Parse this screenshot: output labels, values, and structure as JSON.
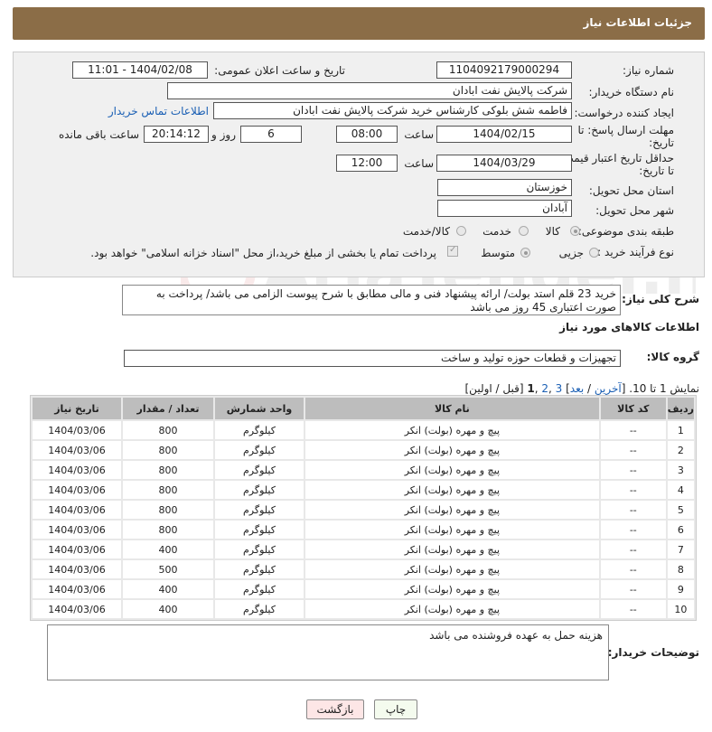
{
  "header": {
    "title": "جزئیات اطلاعات نیاز"
  },
  "form": {
    "need_number_label": "شماره نیاز:",
    "need_number": "1104092179000294",
    "announce_label": "تاریخ و ساعت اعلان عمومی:",
    "announce_value": "1404/02/08 - 11:01",
    "buyer_org_label": "نام دستگاه خریدار:",
    "buyer_org": "شرکت پالایش نفت ابادان",
    "creator_label": "ایجاد کننده درخواست:",
    "creator": "فاطمه شش بلوکی کارشناس خرید شرکت پالایش نفت ابادان",
    "contact_link": "اطلاعات تماس خریدار",
    "deadline_label1": "مهلت ارسال پاسخ: تا",
    "deadline_label2": "تاریخ:",
    "deadline_date": "1404/02/15",
    "time_label": "ساعت",
    "deadline_time": "08:00",
    "days_value": "6",
    "days_label": "روز و",
    "remaining_time": "20:14:12",
    "remaining_label": "ساعت باقی مانده",
    "price_valid_label1": "حداقل تاریخ اعتبار قیمت:",
    "price_valid_label2": "تا تاریخ:",
    "price_valid_date": "1404/03/29",
    "price_valid_time": "12:00",
    "province_label": "استان محل تحویل:",
    "province": "خوزستان",
    "city_label": "شهر محل تحویل:",
    "city": "آبادان",
    "category_label": "طبقه بندی موضوعی:",
    "category_options": [
      "کالا",
      "خدمت",
      "کالا/خدمت"
    ],
    "process_label": "نوع فرآیند خرید :",
    "process_options": [
      "جزیی",
      "متوسط"
    ],
    "payment_note": "پرداخت تمام یا بخشی از مبلغ خرید،از محل \"اسناد خزانه اسلامی\" خواهد بود."
  },
  "description": {
    "label": "شرح کلی نیاز:",
    "text": "خرید 23 قلم استد بولت/ ارائه پیشنهاد فنی و مالی مطابق با شرح پیوست الزامی می باشد/ پرداخت به صورت اعتباری 45 روز می باشد"
  },
  "goods": {
    "section_title": "اطلاعات کالاهای مورد نیاز",
    "group_label": "گروه کالا:",
    "group_value": "تجهیزات و قطعات حوزه تولید و ساخت",
    "pagination_prefix": "نمایش 1 تا 10. [",
    "pagination_last": "آخرین",
    "pagination_next": "بعد",
    "pagination_p3": "3",
    "pagination_p2": "2",
    "pagination_p1": "1",
    "pagination_suffix": "[قبل / اولین]",
    "columns": [
      "ردیف",
      "کد کالا",
      "نام کالا",
      "واحد شمارش",
      "تعداد / مقدار",
      "تاریخ نیاز"
    ],
    "rows": [
      [
        "1",
        "--",
        "پیچ و مهره (بولت) انکر",
        "کیلوگرم",
        "800",
        "1404/03/06"
      ],
      [
        "2",
        "--",
        "پیچ و مهره (بولت) انکر",
        "کیلوگرم",
        "800",
        "1404/03/06"
      ],
      [
        "3",
        "--",
        "پیچ و مهره (بولت) انکر",
        "کیلوگرم",
        "800",
        "1404/03/06"
      ],
      [
        "4",
        "--",
        "پیچ و مهره (بولت) انکر",
        "کیلوگرم",
        "800",
        "1404/03/06"
      ],
      [
        "5",
        "--",
        "پیچ و مهره (بولت) انکر",
        "کیلوگرم",
        "800",
        "1404/03/06"
      ],
      [
        "6",
        "--",
        "پیچ و مهره (بولت) انکر",
        "کیلوگرم",
        "800",
        "1404/03/06"
      ],
      [
        "7",
        "--",
        "پیچ و مهره (بولت) انکر",
        "کیلوگرم",
        "400",
        "1404/03/06"
      ],
      [
        "8",
        "--",
        "پیچ و مهره (بولت) انکر",
        "کیلوگرم",
        "500",
        "1404/03/06"
      ],
      [
        "9",
        "--",
        "پیچ و مهره (بولت) انکر",
        "کیلوگرم",
        "400",
        "1404/03/06"
      ],
      [
        "10",
        "--",
        "پیچ و مهره (بولت) انکر",
        "کیلوگرم",
        "400",
        "1404/03/06"
      ]
    ]
  },
  "buyer_notes": {
    "label": "توضیحات خریدار:",
    "text": "هزینه حمل به عهده فروشنده می باشد"
  },
  "buttons": {
    "print": "چاپ",
    "back": "بازگشت"
  },
  "watermark": {
    "text": "AriaTender.net"
  }
}
